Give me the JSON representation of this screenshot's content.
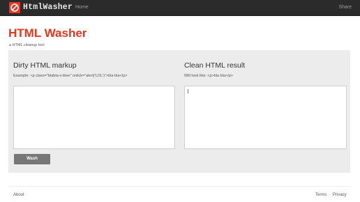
{
  "header": {
    "brand": "HtmlWasher",
    "nav_home": "Home",
    "nav_share": "Share",
    "logo_icon": "no-symbol-icon",
    "bar_color": "#2b2b2b"
  },
  "page": {
    "title": "HTML Washer",
    "subtitle": "a HTML cleanup tool",
    "title_color": "#e8351d"
  },
  "dirty": {
    "title": "Dirty HTML markup",
    "hint": "Example: <p class=\"blabla-x-blee\" onlick=\"alert('LOL')\">bla bla</p>",
    "value": ""
  },
  "clean": {
    "title": "Clean HTML result",
    "hint": "Will look like: <p>bla bla</p>",
    "value": ""
  },
  "actions": {
    "wash_label": "Wash"
  },
  "footer": {
    "about": "About",
    "terms": "Terms",
    "privacy": "Privacy"
  }
}
